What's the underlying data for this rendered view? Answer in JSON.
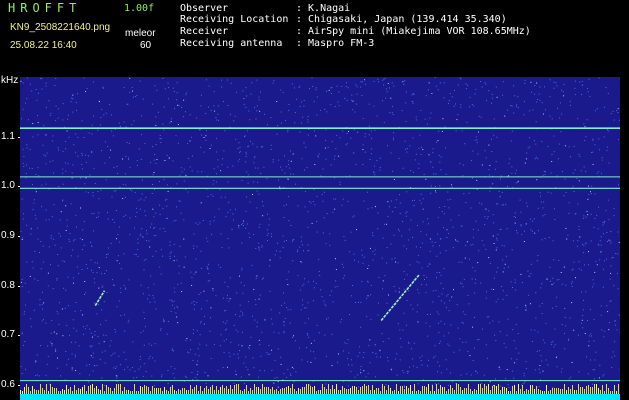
{
  "header": {
    "logo": "HROFFT",
    "version": "1.00f",
    "filename": "KN9_2508221640.png",
    "datetime": "25.08.22 16:40",
    "mode": "meleor",
    "count": "60",
    "info": [
      {
        "label": "Observer",
        "value": ": K.Nagai"
      },
      {
        "label": "Receiving Location",
        "value": ": Chigasaki, Japan (139.414 35.340)"
      },
      {
        "label": "Receiver",
        "value": ": AirSpy mini (Miakejima VOR 108.65MHz)"
      },
      {
        "label": "Receiving antenna",
        "value": ": Maspro FM-3"
      }
    ]
  },
  "colors": {
    "background": "#1a1a8c",
    "noise": "#4a6cf0",
    "carrier": "#7ff0c8",
    "meteor": "#9cf0c0",
    "power_bar": "#00e5ff",
    "power_spike": "#ffff40",
    "label_green": "#8ef05a",
    "label_yellow": "#f4f47a"
  },
  "chart_data": {
    "type": "heatmap",
    "title": "",
    "xlabel": "",
    "ylabel": "kHz",
    "x_ticks": [
      "1641",
      "1642",
      "1643",
      "1644",
      "1645",
      "1646",
      "1647",
      "1648",
      "1649",
      "1650"
    ],
    "x_range": [
      1640.5,
      1650.3
    ],
    "y_ticks": [
      "1.1",
      "1.0",
      "0.9",
      "0.8",
      "0.7",
      "0.6"
    ],
    "y_range": [
      0.57,
      1.22
    ],
    "carriers_khz": [
      1.117,
      1.019,
      0.996,
      0.609
    ],
    "meteor_echoes": [
      {
        "x": [
          1641.73,
          1641.88
        ],
        "y": [
          0.76,
          0.79
        ]
      },
      {
        "x": [
          1646.4,
          1647.02
        ],
        "y": [
          0.73,
          0.822
        ]
      }
    ],
    "grid": false,
    "legend": "none"
  }
}
